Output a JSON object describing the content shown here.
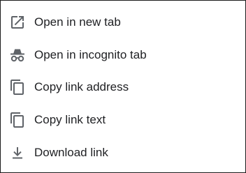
{
  "context_menu": {
    "items": [
      {
        "label": "Open in new tab",
        "icon": "open-in-new-icon"
      },
      {
        "label": "Open in incognito tab",
        "icon": "incognito-icon"
      },
      {
        "label": "Copy link address",
        "icon": "copy-icon"
      },
      {
        "label": "Copy link text",
        "icon": "copy-icon"
      },
      {
        "label": "Download link",
        "icon": "download-icon"
      }
    ]
  },
  "colors": {
    "text": "#202124",
    "icon": "#5f6368",
    "border": "#1c1c1c",
    "background": "#ffffff"
  }
}
